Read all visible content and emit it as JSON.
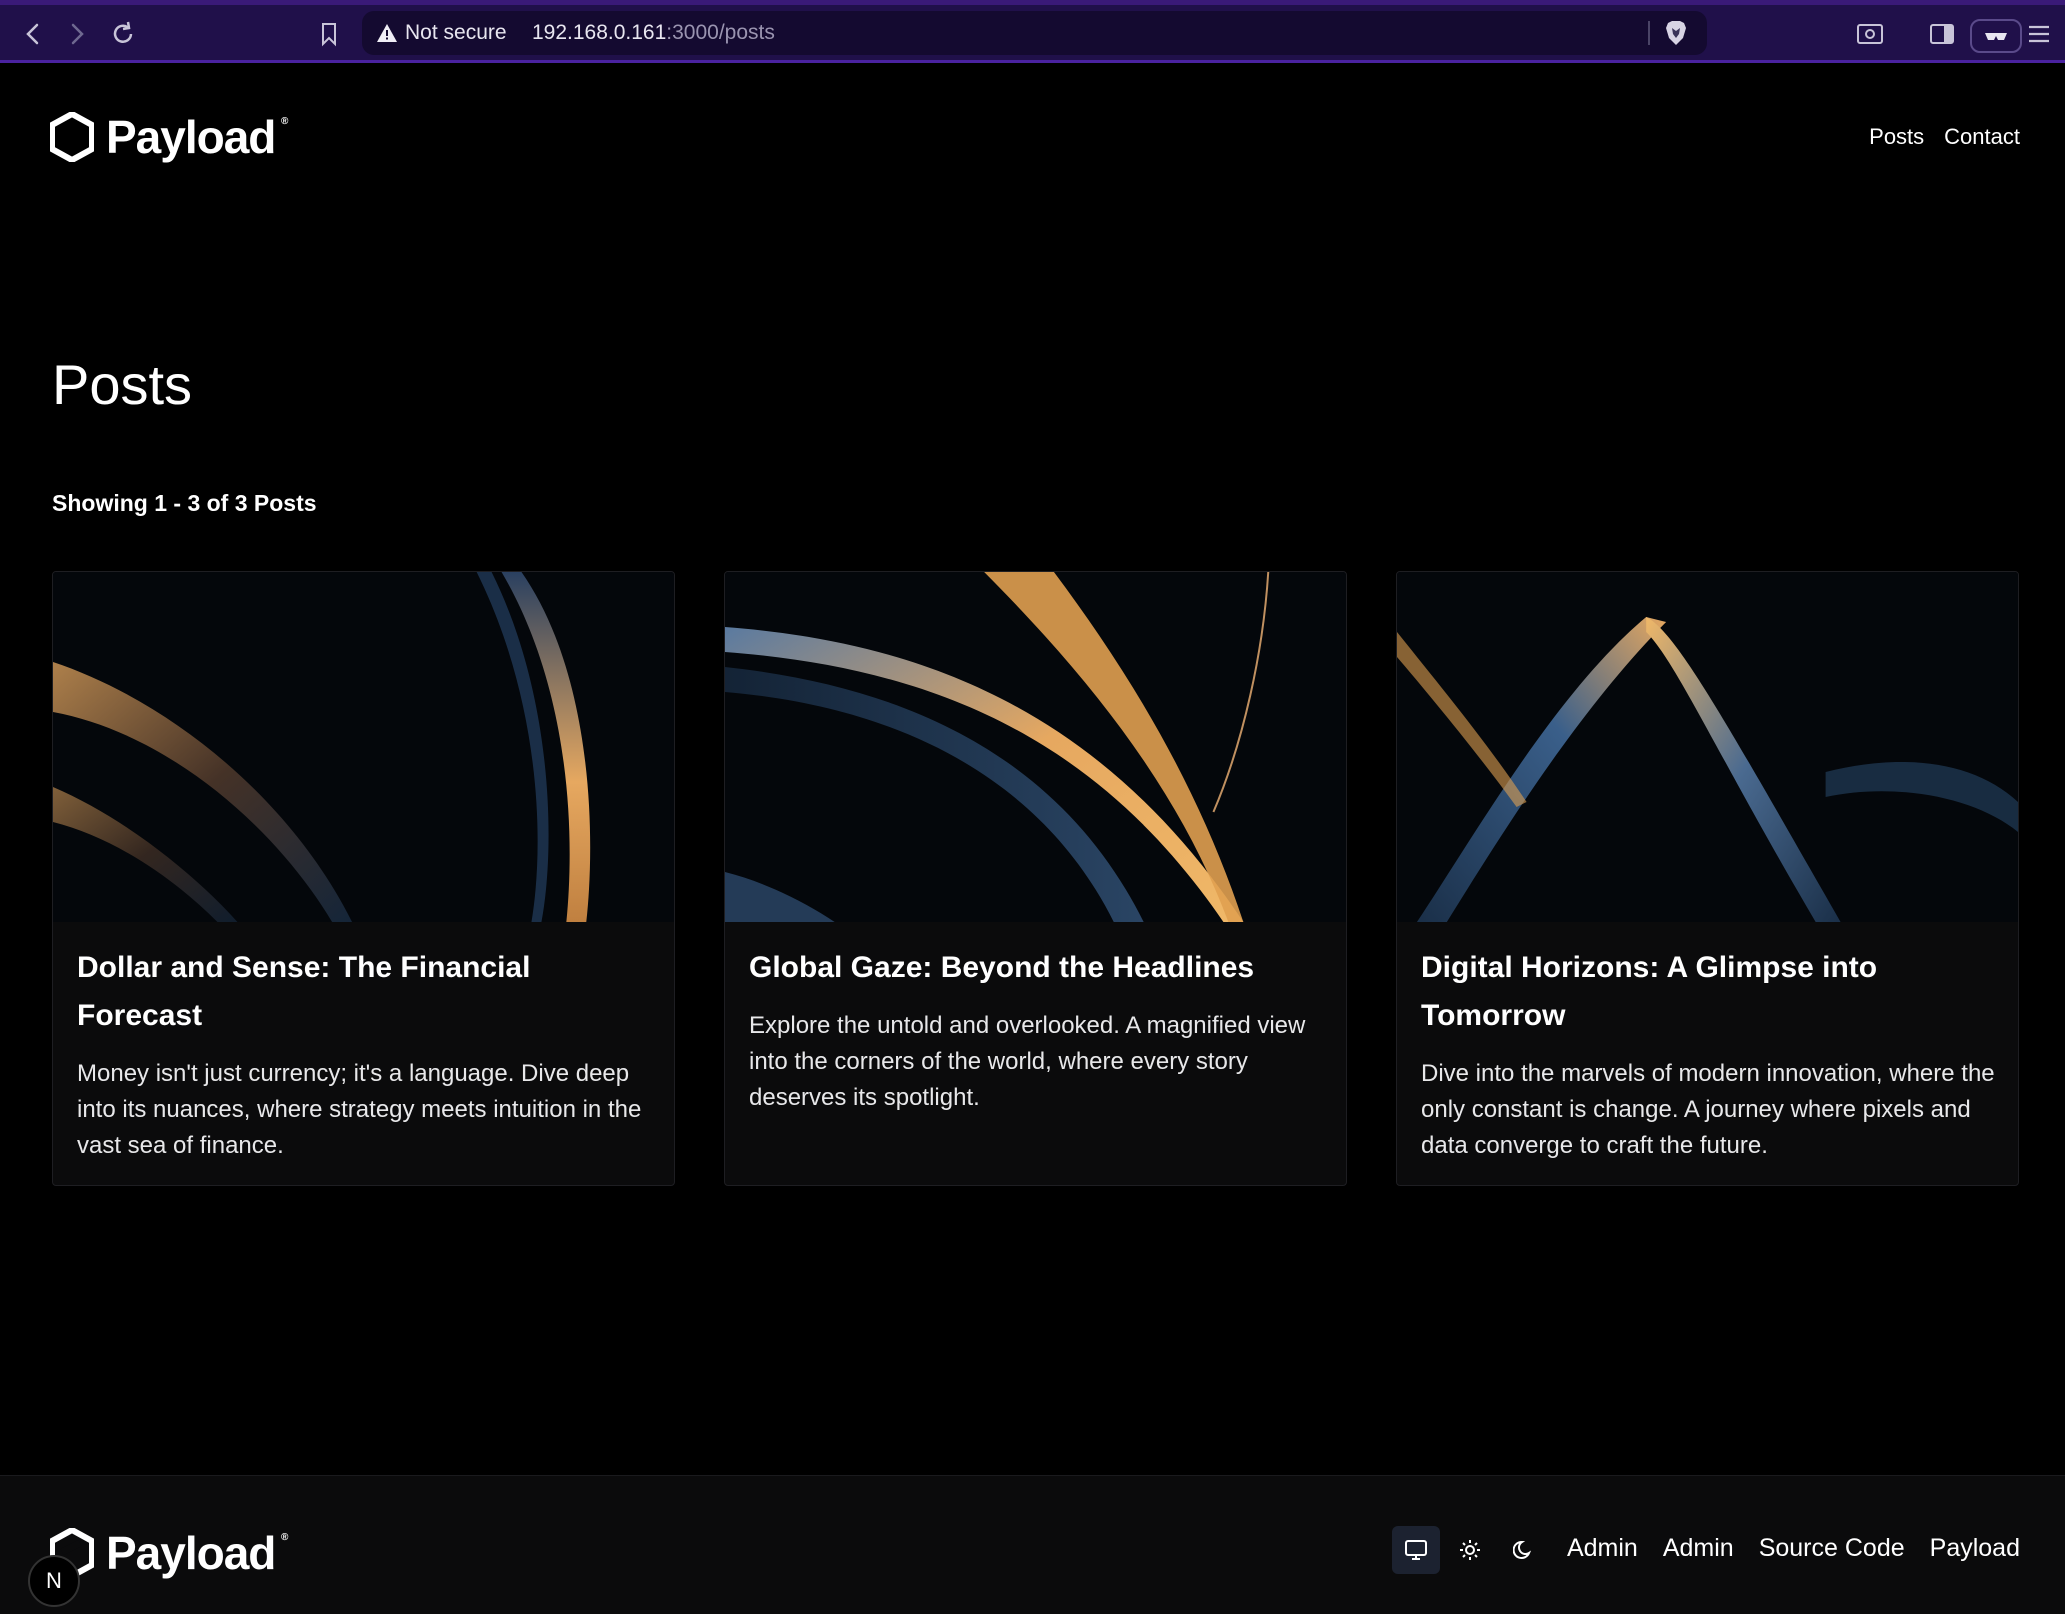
{
  "browser": {
    "security_label": "Not secure",
    "url_host": "192.168.0.161",
    "url_path": ":3000/posts"
  },
  "header": {
    "logo_text": "Payload",
    "logo_mark": "®",
    "nav": [
      {
        "label": "Posts"
      },
      {
        "label": "Contact"
      }
    ]
  },
  "main": {
    "title": "Posts",
    "showing": "Showing 1 - 3 of 3 Posts",
    "cards": [
      {
        "title": "Dollar and Sense: The Financial Forecast",
        "description": "Money isn't just currency; it's a language. Dive deep into its nuances, where strategy meets intuition in the vast sea of finance."
      },
      {
        "title": "Global Gaze: Beyond the Headlines",
        "description": "Explore the untold and overlooked. A magnified view into the corners of the world, where every story deserves its spotlight."
      },
      {
        "title": "Digital Horizons: A Glimpse into Tomorrow",
        "description": "Dive into the marvels of modern innovation, where the only constant is change. A journey where pixels and data converge to craft the future."
      }
    ]
  },
  "footer": {
    "logo_text": "Payload",
    "logo_mark": "®",
    "links": [
      {
        "label": "Admin"
      },
      {
        "label": "Admin"
      },
      {
        "label": "Source Code"
      },
      {
        "label": "Payload"
      }
    ],
    "badge": "N"
  },
  "colors": {
    "chrome": "#20104a",
    "background": "#000000",
    "card": "#0b0b0c",
    "accent_gold": "#e0a050",
    "accent_blue": "#3a5f8a"
  }
}
